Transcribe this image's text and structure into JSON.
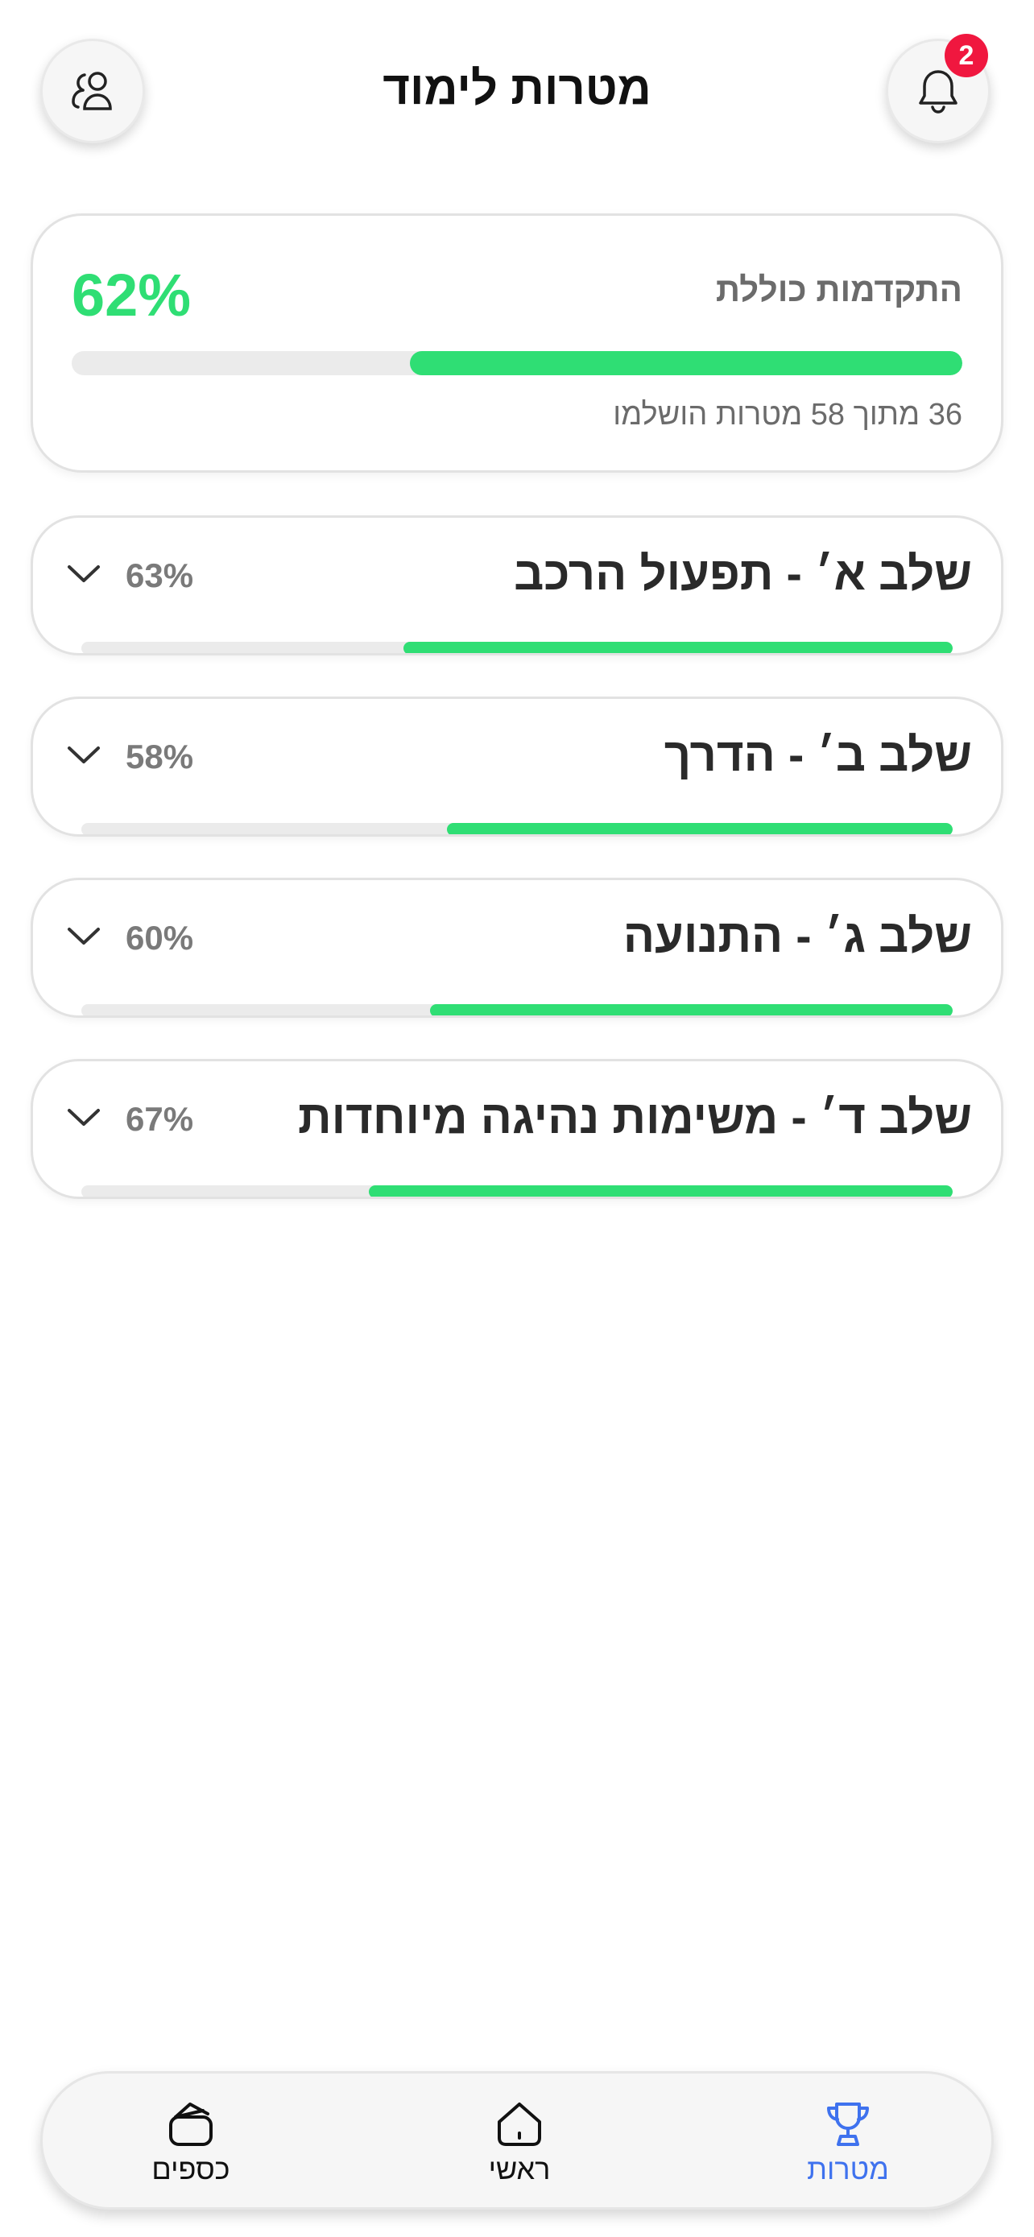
{
  "header": {
    "title": "מטרות לימוד",
    "notification_count": "2",
    "left_icon": "users-icon",
    "right_icon": "bell-icon"
  },
  "overall": {
    "label": "התקדמות כוללת",
    "percent_text": "62%",
    "progress": 0.62,
    "summary": "36 מתוך 58 מטרות הושלמו"
  },
  "stages": [
    {
      "title": "שלב א׳ - תפעול הרכב",
      "percent_text": "63%",
      "progress": 0.63
    },
    {
      "title": "שלב ב׳ - הדרך",
      "percent_text": "58%",
      "progress": 0.58
    },
    {
      "title": "שלב ג׳ - התנועה",
      "percent_text": "60%",
      "progress": 0.6
    },
    {
      "title": "שלב ד׳ - משימות נהיגה מיוחדות",
      "percent_text": "67%",
      "progress": 0.67
    }
  ],
  "tabbar": {
    "tabs": [
      {
        "label": "מטרות",
        "icon": "trophy-icon",
        "active": true
      },
      {
        "label": "ראשי",
        "icon": "home-icon",
        "active": false
      },
      {
        "label": "כספים",
        "icon": "wallet-icon",
        "active": false
      }
    ]
  },
  "colors": {
    "accent_green": "#2fde74",
    "active_tab_blue": "#3f72ee",
    "badge_red": "#f0173f"
  }
}
